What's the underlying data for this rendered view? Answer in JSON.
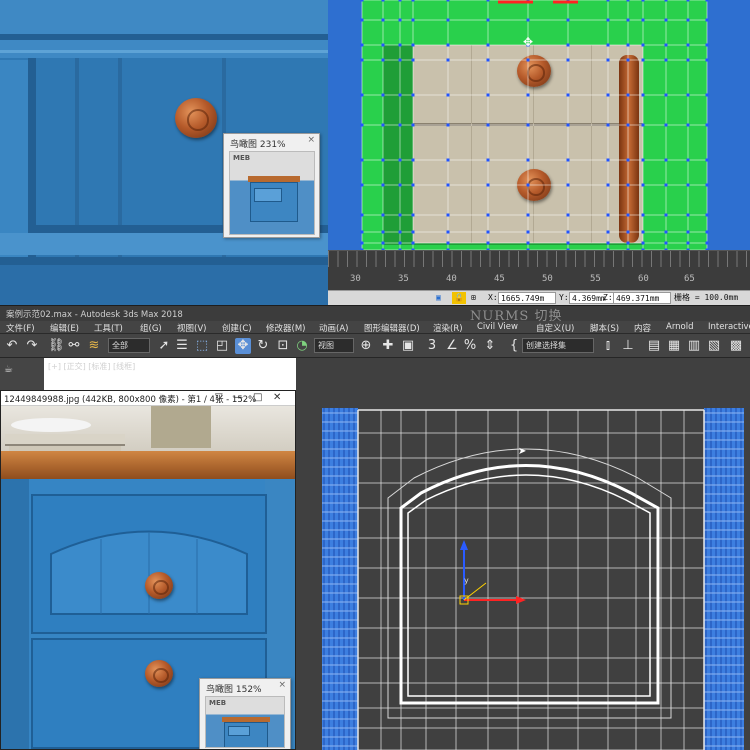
{
  "top_photo": {
    "birdview_title": "鸟瞰图 231%",
    "birdview_close": "×",
    "birdview_logo": "MEB"
  },
  "uv_ruler": {
    "ticks": [
      "30",
      "35",
      "40",
      "45",
      "50",
      "55",
      "60",
      "65"
    ]
  },
  "coord_bar": {
    "x_label": "X:",
    "x_value": "1665.749m",
    "y_label": "Y:",
    "y_value": "4.369mm",
    "z_label": "Z:",
    "z_value": "469.371mm",
    "grid": "栅格 = 100.0mm"
  },
  "titlebar": {
    "title": "案例示范02.max - Autodesk 3ds Max 2018",
    "nurms": "NURMS 切换"
  },
  "menubar": {
    "items": [
      "文件(F)",
      "编辑(E)",
      "工具(T)",
      "组(G)",
      "视图(V)",
      "创建(C)",
      "修改器(M)",
      "动画(A)",
      "图形编辑器(D)",
      "渲染(R)",
      "Civil View",
      "自定义(U)",
      "脚本(S)",
      "内容",
      "Arnold",
      "Interactive"
    ]
  },
  "toolbar": {
    "selection_filter": "全部",
    "ref_coord": "视图",
    "named_selection": "创建选择集"
  },
  "viewport": {
    "label": "[+] [正交] [标准] [线框]",
    "axis_y": "y"
  },
  "image_viewer": {
    "title": "12449849988.jpg (442KB, 800x800 像素) - 第1 / 4张 - 152%",
    "controls": [
      "▽",
      "—",
      "□",
      "✕"
    ],
    "birdview_title": "鸟瞰图 152%",
    "birdview_close": "×",
    "birdview_logo": "MEB"
  },
  "colors": {
    "cabinet_blue": "#2f78b3",
    "uv_green": "#29d04c",
    "selection_blue": "#2e6fd0",
    "max_ui_dark": "#444444"
  }
}
